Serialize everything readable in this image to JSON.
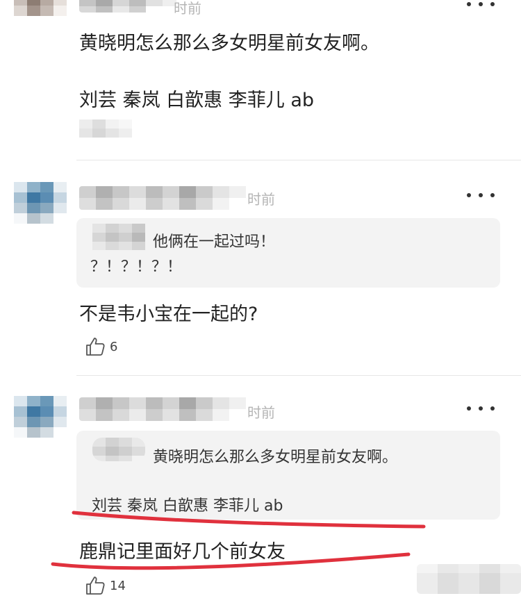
{
  "comments": [
    {
      "time_suffix": "时前",
      "text_line1": "黄晓明怎么那么多女明星前女友啊。",
      "text_line2": "刘芸 秦岚 白歆惠 李菲儿 ab"
    },
    {
      "time_suffix": "时前",
      "quote_line1": "他俩在一起过吗！",
      "quote_line2": "？！？！？！",
      "text": "不是韦小宝在一起的?",
      "likes": "6"
    },
    {
      "time_suffix": "时前",
      "quote_line1": "黄晓明怎么那么多女明星前女友啊。",
      "quote_line2": "刘芸 秦岚 白歆惠 李菲儿 ab",
      "text": "鹿鼎记里面好几个前女友",
      "likes": "14"
    }
  ],
  "colors": {
    "annotation": "#e0313d",
    "quote_background": "#f3f3f3",
    "timestamp": "#b5b5b5"
  },
  "icons": {
    "more": "more-dots-icon",
    "like": "thumbs-up-icon"
  }
}
